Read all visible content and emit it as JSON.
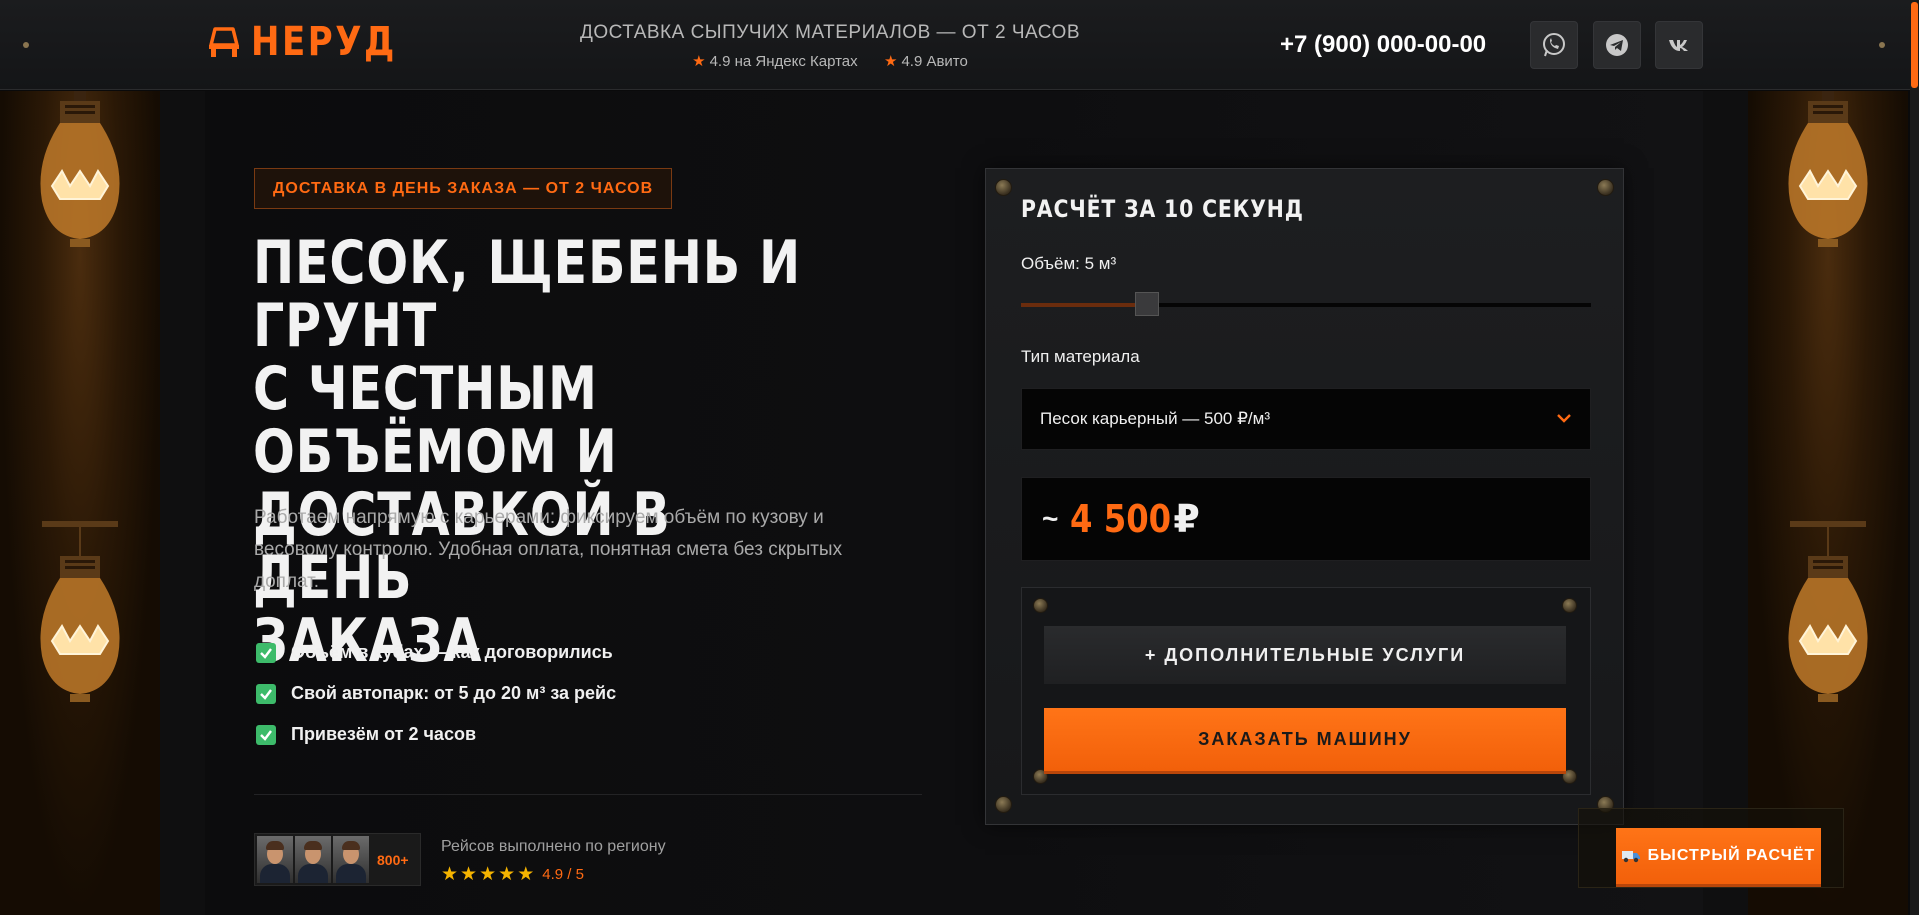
{
  "header": {
    "brand": "НЕРУД",
    "tagline": "ДОСТАВКА СЫПУЧИХ МАТЕРИАЛОВ — ОТ 2 ЧАСОВ",
    "rating_yandex": "4.9 на Яндекс Картах",
    "rating_avito": "4.9 Авито",
    "phone": "+7 (900) 000-00-00",
    "social": [
      "whatsapp-icon",
      "telegram-icon",
      "vk-icon"
    ]
  },
  "hero": {
    "badge": "ДОСТАВКА В ДЕНЬ ЗАКАЗА — ОТ 2 ЧАСОВ",
    "title_lines": [
      "ПЕСОК, ЩЕБЕНЬ И ГРУНТ",
      "С ЧЕСТНЫМ ОБЪЁМОМ И",
      "ДОСТАВКОЙ В ДЕНЬ",
      "ЗАКАЗА"
    ],
    "description": "Работаем напрямую с карьерами: фиксируем объём по кузову и весовому контролю. Удобная оплата, понятная смета без скрытых доплат.",
    "features": [
      "Объём в кубах — как договорились",
      "Свой автопарк: от 5 до 20 м³ за рейс",
      "Привезём от 2 часов"
    ],
    "trips_count": "800+",
    "trips_label": "Рейсов выполнено по региону",
    "rating_score": "4.9 / 5",
    "rating_stars": 5
  },
  "calculator": {
    "title": "РАСЧЁТ ЗА 10 СЕКУНД",
    "volume_label": "Объём: 5 м³",
    "volume_value": 5,
    "volume_min": 0,
    "volume_max": 22.6,
    "material_label": "Тип материала",
    "material_selected": "Песок карьерный — 500 ₽/м³",
    "price_prefix": "~",
    "price_value": "4 500",
    "price_currency": "₽",
    "extra_button": "+ ДОПОЛНИТЕЛЬНЫЕ УСЛУГИ",
    "order_button": "ЗАКАЗАТЬ МАШИНУ"
  },
  "quick_calc": {
    "icon": "truck-icon",
    "label": "БЫСТРЫЙ РАСЧЁТ"
  },
  "colors": {
    "accent": "#ff6a13",
    "background": "#0a0a0b",
    "check": "#3dbb6a",
    "star": "#f5b400"
  }
}
